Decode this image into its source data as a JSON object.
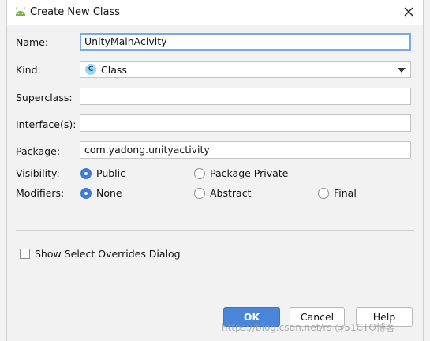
{
  "window": {
    "title": "Create New Class",
    "icon": "android-icon"
  },
  "form": {
    "name": {
      "label": "Name:",
      "value": "UnityMainAcivity"
    },
    "kind": {
      "label": "Kind:",
      "selected": "Class",
      "badge": "C"
    },
    "superclass": {
      "label": "Superclass:",
      "value": ""
    },
    "interfaces": {
      "label": "Interface(s):",
      "value": ""
    },
    "package": {
      "label": "Package:",
      "value": "com.yadong.unityactivity"
    },
    "visibility": {
      "label": "Visibility:",
      "options": [
        {
          "label": "Public",
          "checked": true
        },
        {
          "label": "Package Private",
          "checked": false
        }
      ]
    },
    "modifiers": {
      "label": "Modifiers:",
      "options": [
        {
          "label": "None",
          "checked": true
        },
        {
          "label": "Abstract",
          "checked": false
        },
        {
          "label": "Final",
          "checked": false
        }
      ]
    },
    "show_overrides": {
      "label": "Show Select Overrides Dialog",
      "checked": false
    }
  },
  "buttons": {
    "ok": "OK",
    "cancel": "Cancel",
    "help": "Help"
  },
  "watermark": "https://blog.csdn.net/rs @51CTO博客",
  "colors": {
    "accent": "#4a86d8",
    "focus": "#7aa7e5"
  }
}
